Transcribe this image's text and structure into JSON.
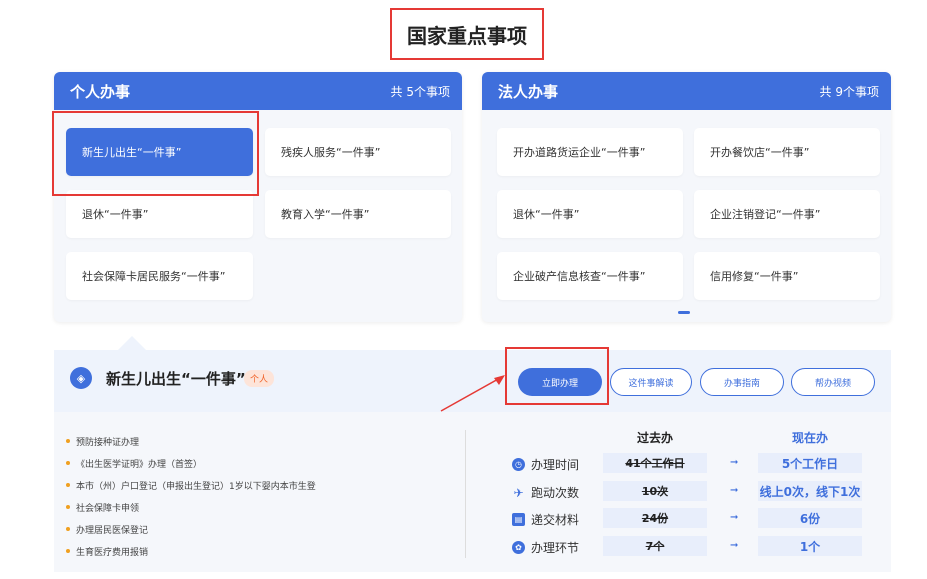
{
  "page_title": "国家重点事项",
  "personal": {
    "title": "个人办事",
    "count": "共 5个事项",
    "items": [
      "新生儿出生“一件事”",
      "残疾人服务“一件事”",
      "退休“一件事”",
      "教育入学“一件事”",
      "社会保障卡居民服务“一件事”"
    ]
  },
  "legal": {
    "title": "法人办事",
    "count": "共 9个事项",
    "items": [
      "开办道路货运企业“一件事”",
      "开办餐饮店“一件事”",
      "退休“一件事”",
      "企业注销登记“一件事”",
      "企业破产信息核查“一件事”",
      "信用修复“一件事”"
    ]
  },
  "detail": {
    "title": "新生儿出生“一件事”",
    "tag": "个人",
    "buttons": {
      "apply": "立即办理",
      "explain": "这件事解读",
      "guide": "办事指南",
      "video": "帮办视频"
    },
    "notes": [
      "预防接种证办理",
      "《出生医学证明》办理（首签）",
      "本市（州）户口登记（申报出生登记）1岁以下婴内本市生登",
      "社会保障卡申领",
      "办理居民医保登记",
      "生育医疗费用报销"
    ],
    "compare": {
      "past_header": "过去办",
      "now_header": "现在办",
      "rows": [
        {
          "label": "办理时间",
          "icon": "clock-icon",
          "past": "41个工作日",
          "now": "5个工作日"
        },
        {
          "label": "跑动次数",
          "icon": "run-icon",
          "past": "10次",
          "now": "线上0次，线下1次"
        },
        {
          "label": "递交材料",
          "icon": "folder-icon",
          "past": "24份",
          "now": "6份"
        },
        {
          "label": "办理环节",
          "icon": "steps-icon",
          "past": "7个",
          "now": "1个"
        }
      ]
    }
  },
  "colors": {
    "accent": "#3f6fdc",
    "highlight": "#e53935",
    "tag": "#f0642a"
  }
}
